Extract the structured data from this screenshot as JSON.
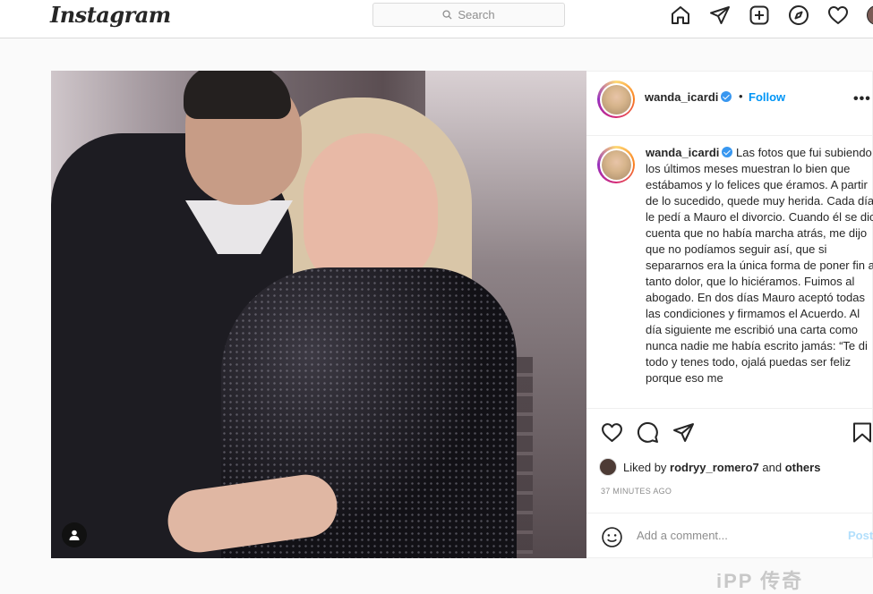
{
  "app": {
    "logo": "Instagram",
    "search_placeholder": "Search"
  },
  "nav": {
    "icons": [
      "home-icon",
      "direct-icon",
      "new-post-icon",
      "explore-icon",
      "activity-icon",
      "profile-avatar"
    ]
  },
  "post": {
    "username": "wanda_icardi",
    "verified": true,
    "separator": "•",
    "follow_label": "Follow",
    "more_label": "•••",
    "caption": "Las fotos que fui subiendo los últimos meses muestran lo bien que estábamos y lo felices que éramos. A partir de lo sucedido, quede muy herida. Cada día le pedí a Mauro el divorcio. Cuando él se dio cuenta que no había marcha atrás, me dijo que no podíamos seguir así, que si separarnos era la única forma de poner fin a tanto dolor, que lo hiciéramos. Fuimos al abogado. En dos días Mauro aceptó todas las condiciones y firmamos el Acuerdo. Al día siguiente me escribió una carta como nunca nadie me había escrito jamás: “Te di todo y tenes todo, ojalá puedas ser feliz porque eso me",
    "likes_prefix": "Liked by",
    "liked_by_user": "rodryy_romero7",
    "likes_and": "and",
    "likes_others": "others",
    "time_ago": "37 MINUTES AGO",
    "comment_placeholder": "Add a comment...",
    "post_button": "Post"
  },
  "watermark": "iPP 传奇"
}
